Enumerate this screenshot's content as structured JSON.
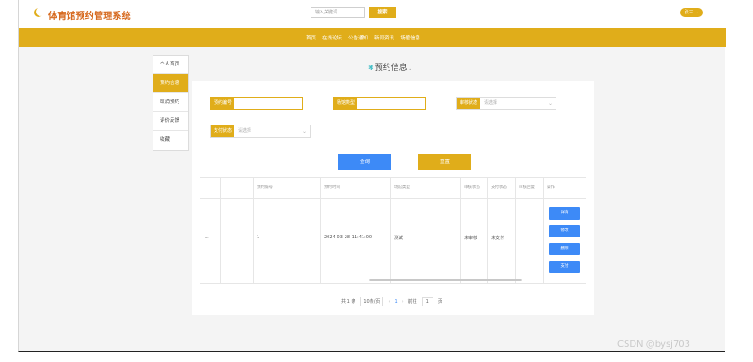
{
  "header": {
    "site_title": "体育馆预约管理系统",
    "search_placeholder": "输入关键词",
    "search_label": "搜索",
    "user_label": "张三 ⌄"
  },
  "nav": [
    "首页",
    "在线论坛",
    "公告通知",
    "新闻资讯",
    "场馆信息"
  ],
  "sidebar": [
    {
      "label": "个人首页",
      "active": false
    },
    {
      "label": "预约信息",
      "active": true
    },
    {
      "label": "取消预约",
      "active": false
    },
    {
      "label": "评价反馈",
      "active": false
    },
    {
      "label": "收藏",
      "active": false
    }
  ],
  "page_title": "预约信息",
  "filters": {
    "f1_label": "预约编号",
    "f2_label": "场馆类型",
    "f3_label": "审核状态",
    "f3_placeholder": "请选择",
    "f4_label": "支付状态",
    "f4_placeholder": "请选择"
  },
  "buttons": {
    "query": "查询",
    "reset": "重置"
  },
  "table": {
    "headers": [
      "",
      "",
      "预约编号",
      "预约时间",
      "场馆类型",
      "审核状态",
      "支付状态",
      "审核回复",
      "操作"
    ],
    "row": [
      "...",
      "",
      "1",
      "2024-03-28 11:41:00",
      "测试",
      "未审核",
      "未支付",
      ""
    ],
    "actions": [
      "详情",
      "修改",
      "删除",
      "支付"
    ]
  },
  "pager": {
    "total": "共 1 条",
    "page_size": "10条/页",
    "prev": "‹",
    "page": "1",
    "next": "›",
    "goto": "前往",
    "goto_page": "1",
    "page_unit": "页"
  },
  "watermark": "CSDN @bysj703",
  "colors": {
    "accent": "#e0ad1a",
    "blue": "#3d8af7",
    "title": "#d6691e"
  }
}
